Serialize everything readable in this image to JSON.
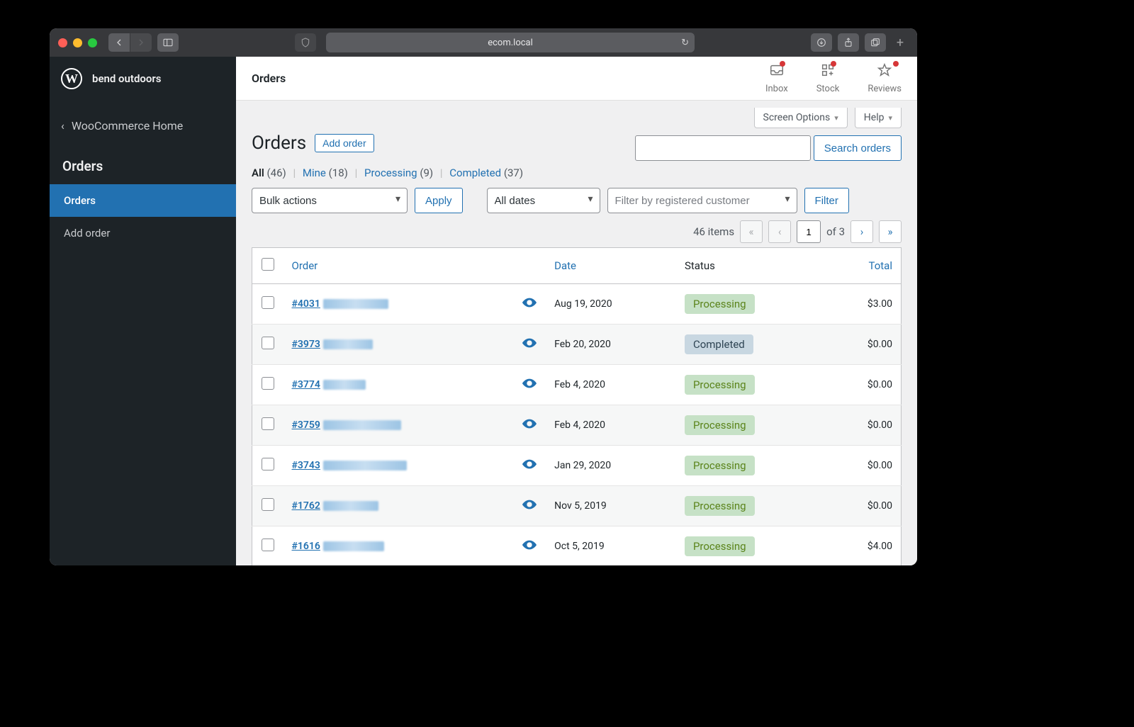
{
  "browser": {
    "address": "ecom.local"
  },
  "site_name": "bend outdoors",
  "sidebar": {
    "back_label": "WooCommerce Home",
    "section": "Orders",
    "items": [
      "Orders",
      "Add order"
    ],
    "active_index": 0
  },
  "topbar": {
    "title": "Orders",
    "icons": [
      {
        "label": "Inbox",
        "dot": true
      },
      {
        "label": "Stock",
        "dot": true
      },
      {
        "label": "Reviews",
        "dot": true
      }
    ]
  },
  "screen_options": "Screen Options",
  "help": "Help",
  "page_title": "Orders",
  "add_button": "Add order",
  "views": {
    "all_label": "All",
    "all_count": "(46)",
    "mine_label": "Mine",
    "mine_count": "(18)",
    "processing_label": "Processing",
    "processing_count": "(9)",
    "completed_label": "Completed",
    "completed_count": "(37)"
  },
  "bulk_select": "Bulk actions",
  "apply_btn": "Apply",
  "dates_select": "All dates",
  "customer_placeholder": "Filter by registered customer",
  "filter_btn": "Filter",
  "search_btn": "Search orders",
  "pager": {
    "count": "46 items",
    "page": "1",
    "of": "of 3"
  },
  "columns": {
    "order": "Order",
    "date": "Date",
    "status": "Status",
    "total": "Total"
  },
  "rows": [
    {
      "id": "#4031",
      "date": "Aug 19, 2020",
      "status": "Processing",
      "status_class": "processing",
      "total": "$3.00",
      "blur_w": 92
    },
    {
      "id": "#3973",
      "date": "Feb 20, 2020",
      "status": "Completed",
      "status_class": "completed",
      "total": "$0.00",
      "blur_w": 70
    },
    {
      "id": "#3774",
      "date": "Feb 4, 2020",
      "status": "Processing",
      "status_class": "processing",
      "total": "$0.00",
      "blur_w": 60
    },
    {
      "id": "#3759",
      "date": "Feb 4, 2020",
      "status": "Processing",
      "status_class": "processing",
      "total": "$0.00",
      "blur_w": 110
    },
    {
      "id": "#3743",
      "date": "Jan 29, 2020",
      "status": "Processing",
      "status_class": "processing",
      "total": "$0.00",
      "blur_w": 118
    },
    {
      "id": "#1762",
      "date": "Nov 5, 2019",
      "status": "Processing",
      "status_class": "processing",
      "total": "$0.00",
      "blur_w": 78
    },
    {
      "id": "#1616",
      "date": "Oct 5, 2019",
      "status": "Processing",
      "status_class": "processing",
      "total": "$4.00",
      "blur_w": 86
    }
  ]
}
